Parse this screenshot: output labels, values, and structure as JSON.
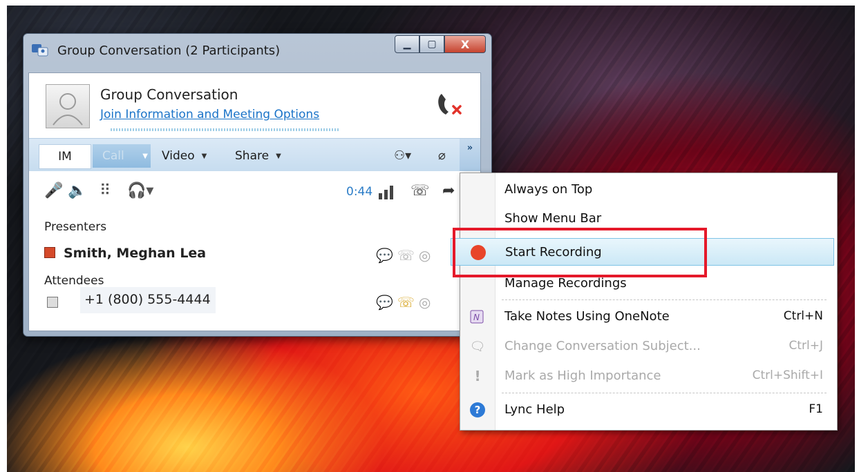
{
  "window": {
    "title": "Group Conversation (2 Participants)",
    "min_glyph": "▁",
    "max_glyph": "▢",
    "close_glyph": "X"
  },
  "header": {
    "title": "Group Conversation",
    "join_link": "Join Information and Meeting Options"
  },
  "tabs": {
    "im": "IM",
    "call": "Call",
    "video": "Video",
    "share": "Share",
    "more": "»"
  },
  "call": {
    "timer": "0:44"
  },
  "participants": {
    "presenters_label": "Presenters",
    "presenter_name": "Smith, Meghan Lea",
    "attendees_label": "Attendees",
    "attendee_phone": "+1 (800) 555-4444"
  },
  "menu": {
    "items": [
      {
        "label": "Always on Top",
        "shortcut": ""
      },
      {
        "label": "Show Menu Bar",
        "shortcut": ""
      },
      {
        "label": "Start Recording",
        "shortcut": ""
      },
      {
        "label": "Manage Recordings",
        "shortcut": ""
      },
      {
        "label": "Take Notes Using OneNote",
        "shortcut": "Ctrl+N"
      },
      {
        "label": "Change Conversation Subject...",
        "shortcut": "Ctrl+J"
      },
      {
        "label": "Mark as High Importance",
        "shortcut": "Ctrl+Shift+I"
      },
      {
        "label": "Lync Help",
        "shortcut": "F1"
      }
    ]
  },
  "colors": {
    "record_dot": "#e8452a",
    "highlight_box": "#e5192a",
    "link": "#1a73c8"
  }
}
